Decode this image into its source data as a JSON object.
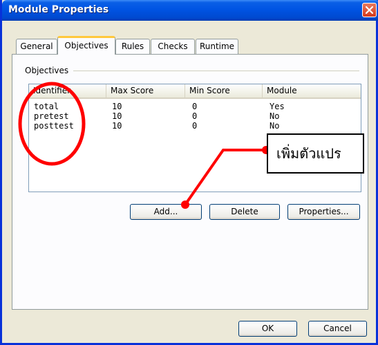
{
  "window": {
    "title": "Module Properties"
  },
  "tabs": [
    {
      "label": "General"
    },
    {
      "label": "Objectives"
    },
    {
      "label": "Rules"
    },
    {
      "label": "Checks"
    },
    {
      "label": "Runtime"
    }
  ],
  "objectives": {
    "group_label": "Objectives",
    "columns": [
      "Identifier",
      "Max Score",
      "Min Score",
      "Module"
    ],
    "rows": [
      [
        "total",
        "10",
        "0",
        "Yes"
      ],
      [
        "pretest",
        "10",
        "0",
        "No"
      ],
      [
        "posttest",
        "10",
        "0",
        "No"
      ]
    ]
  },
  "list_buttons": {
    "add_label": "Add...",
    "delete_label": "Delete",
    "properties_label": "Properties..."
  },
  "dialog_buttons": {
    "ok_label": "OK",
    "cancel_label": "Cancel"
  },
  "annotation": {
    "callout_text": "เพิ่มตัวแปร",
    "color": "#ff0000"
  }
}
